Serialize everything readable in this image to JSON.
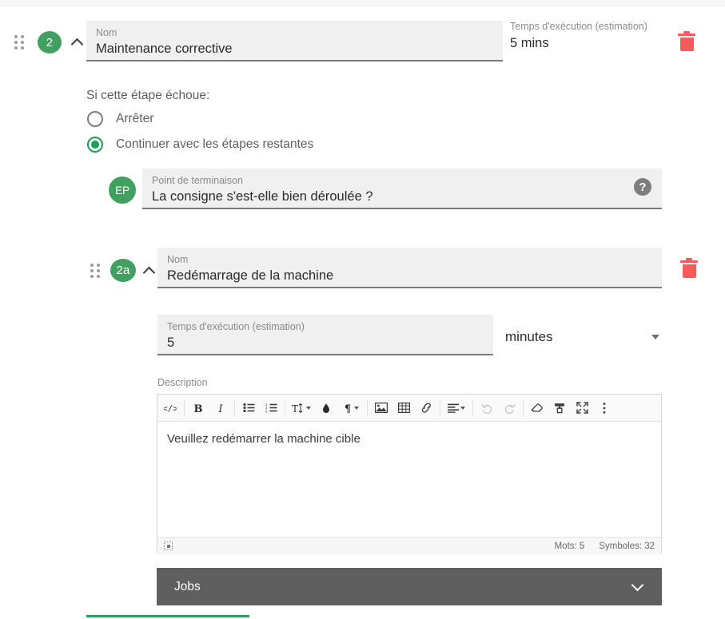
{
  "step_main": {
    "badge": "2",
    "name_label": "Nom",
    "name_value": "Maintenance corrective",
    "exec_label": "Temps d'exécution (estimation)",
    "exec_value": "5 mins",
    "drag_icon": "drag-handle-icon",
    "collapse_icon": "chevron-up-icon",
    "delete_icon": "trash-icon"
  },
  "failure": {
    "title": "Si cette étape échoue:",
    "options": [
      {
        "label": "Arrêter",
        "checked": false
      },
      {
        "label": "Continuer avec les étapes restantes",
        "checked": true
      }
    ]
  },
  "endpoint": {
    "avatar": "EP",
    "label": "Point de terminaison",
    "value": "La consigne s'est-elle bien déroulée ?",
    "help_icon": "help-circle-icon"
  },
  "substep": {
    "badge": "2a",
    "name_label": "Nom",
    "name_value": "Redémarrage de la machine",
    "exec_label": "Temps d'exécution (estimation)",
    "exec_value": "5",
    "unit_value": "minutes",
    "unit_icon": "chevron-down-icon",
    "drag_icon": "drag-handle-icon",
    "collapse_icon": "chevron-up-icon",
    "delete_icon": "trash-icon"
  },
  "description": {
    "label": "Description",
    "content": "Veuillez redémarrer la machine cible",
    "toolbar": [
      {
        "name": "code-view-icon",
        "glyph": "</>",
        "caret": false,
        "disabled": false
      },
      {
        "name": "separator",
        "glyph": "",
        "caret": false,
        "disabled": false
      },
      {
        "name": "bold-icon",
        "glyph": "B",
        "caret": false,
        "disabled": false
      },
      {
        "name": "italic-icon",
        "glyph": "I",
        "caret": false,
        "disabled": false
      },
      {
        "name": "separator",
        "glyph": "",
        "caret": false,
        "disabled": false
      },
      {
        "name": "unordered-list-icon",
        "glyph": "☰",
        "caret": false,
        "disabled": false
      },
      {
        "name": "ordered-list-icon",
        "glyph": "☰",
        "caret": false,
        "disabled": false
      },
      {
        "name": "separator",
        "glyph": "",
        "caret": false,
        "disabled": false
      },
      {
        "name": "font-size-icon",
        "glyph": "T",
        "caret": true,
        "disabled": false
      },
      {
        "name": "text-color-icon",
        "glyph": "◆",
        "caret": false,
        "disabled": false
      },
      {
        "name": "paragraph-format-icon",
        "glyph": "¶",
        "caret": true,
        "disabled": false
      },
      {
        "name": "separator",
        "glyph": "",
        "caret": false,
        "disabled": false
      },
      {
        "name": "insert-image-icon",
        "glyph": "▣",
        "caret": false,
        "disabled": false
      },
      {
        "name": "insert-table-icon",
        "glyph": "▦",
        "caret": false,
        "disabled": false
      },
      {
        "name": "insert-link-icon",
        "glyph": "🔗",
        "caret": false,
        "disabled": false
      },
      {
        "name": "separator",
        "glyph": "",
        "caret": false,
        "disabled": false
      },
      {
        "name": "align-icon",
        "glyph": "≡",
        "caret": true,
        "disabled": false
      },
      {
        "name": "separator",
        "glyph": "",
        "caret": false,
        "disabled": false
      },
      {
        "name": "undo-icon",
        "glyph": "↺",
        "caret": false,
        "disabled": true
      },
      {
        "name": "redo-icon",
        "glyph": "↻",
        "caret": false,
        "disabled": true
      },
      {
        "name": "separator",
        "glyph": "",
        "caret": false,
        "disabled": false
      },
      {
        "name": "clear-formatting-icon",
        "glyph": "▱",
        "caret": false,
        "disabled": false
      },
      {
        "name": "paint-format-icon",
        "glyph": "⌶",
        "caret": false,
        "disabled": false
      },
      {
        "name": "fullscreen-icon",
        "glyph": "⤢",
        "caret": false,
        "disabled": false
      },
      {
        "name": "more-options-icon",
        "glyph": "⋮",
        "caret": false,
        "disabled": false
      }
    ],
    "footer": {
      "resize_icon": "resize-handle-icon",
      "words": "Mots: 5",
      "chars": "Symboles: 32"
    }
  },
  "jobs": {
    "label": "Jobs",
    "expand_icon": "chevron-down-icon"
  },
  "colors": {
    "green": "#41a05f",
    "red": "#fb5a5a",
    "jobs_bar": "#5f5f5f",
    "field_bg": "#f0f0f0"
  }
}
